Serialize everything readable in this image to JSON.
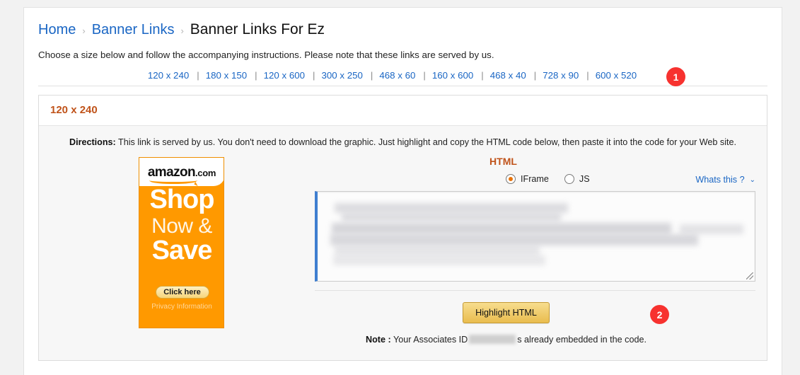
{
  "breadcrumb": {
    "home": "Home",
    "parent": "Banner Links",
    "current": "Banner Links For Ez",
    "separator": "›"
  },
  "intro": "Choose a size below and follow the accompanying instructions. Please note that these links are served by us.",
  "sizes": [
    {
      "label": "120 x 240"
    },
    {
      "label": "180 x 150"
    },
    {
      "label": "120 x 600"
    },
    {
      "label": "300 x 250"
    },
    {
      "label": "468 x 60"
    },
    {
      "label": "160 x 600"
    },
    {
      "label": "468 x 40"
    },
    {
      "label": "728 x 90"
    },
    {
      "label": "600 x 520"
    }
  ],
  "size_separator": "|",
  "annotations": {
    "badge_one": "1",
    "badge_two": "2"
  },
  "panel": {
    "title": "120 x 240",
    "directions_label": "Directions:",
    "directions_text": "This link is served by us. You don't need to download the graphic. Just highlight and copy the HTML code below, then paste it into the code for your Web site."
  },
  "banner": {
    "logo": "amazon",
    "logo_suffix": ".com",
    "line1": "Shop",
    "line2": "Now &",
    "line3": "Save",
    "cta": "Click here",
    "privacy": "Privacy Information"
  },
  "code_panel": {
    "title": "HTML",
    "options": [
      {
        "label": "IFrame",
        "selected": true
      },
      {
        "label": "JS",
        "selected": false
      }
    ],
    "whats_this": "Whats this ?",
    "chevron": "⌄",
    "textarea_value": ""
  },
  "actions": {
    "highlight_button": "Highlight HTML",
    "note_label": "Note :",
    "note_before": "Your Associates ID",
    "note_after": "s already embedded in the code."
  },
  "colors": {
    "accent_orange": "#c0531a",
    "link_blue": "#1a66c4",
    "badge_red": "#f7322f",
    "banner_orange": "#ff9900",
    "button_gold": "#e9bc4e",
    "focus_blue": "#3f7fd0"
  }
}
